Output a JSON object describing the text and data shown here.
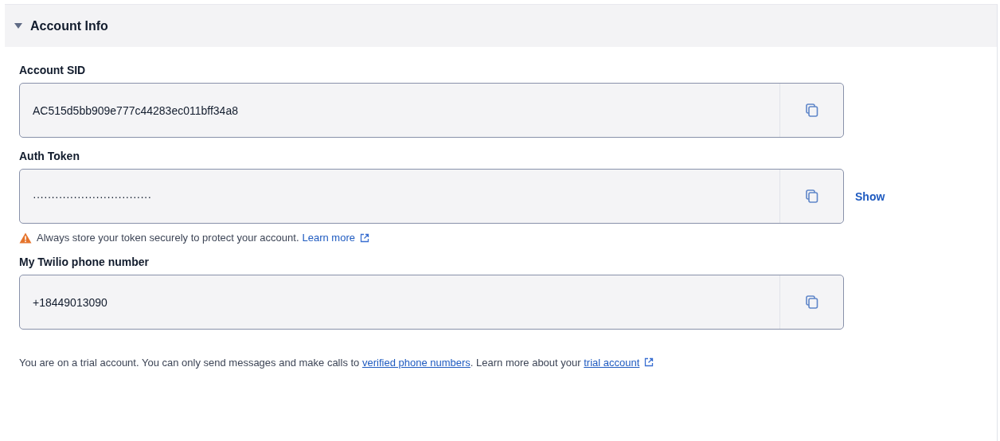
{
  "section": {
    "title": "Account Info",
    "expanded": true
  },
  "fields": [
    {
      "kind": "plain",
      "label": "Account SID",
      "value": "AC515d5bb909e777c44283ec011bff34a8"
    },
    {
      "kind": "secret",
      "label": "Auth Token",
      "value": "································",
      "show_link": "Show",
      "warning": "Always store your token securely to protect your account.",
      "warning_link": "Learn more"
    },
    {
      "kind": "plain",
      "label": "My Twilio phone number",
      "value": "+18449013090"
    }
  ],
  "footer": {
    "text_before": "You are on a trial account. You can only send messages and make calls to",
    "link1": "verified phone numbers",
    "text_middle": ". Learn more about your",
    "link2": "trial account"
  }
}
